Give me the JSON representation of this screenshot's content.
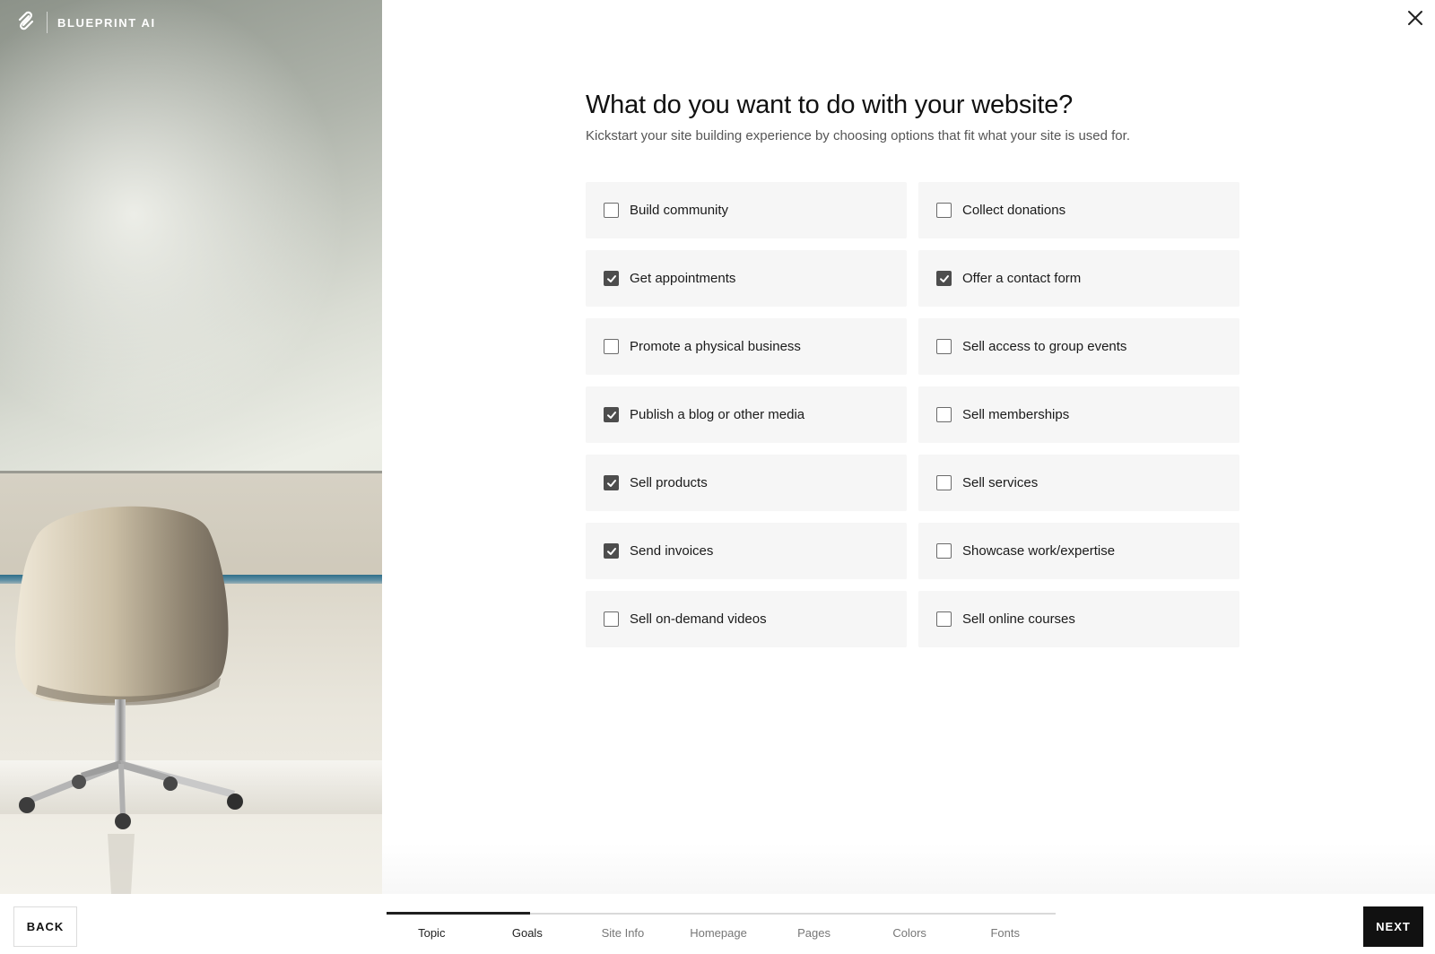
{
  "brand": {
    "name": "BLUEPRINT AI",
    "logo_icon": "squarespace-logo-icon"
  },
  "close": {
    "icon": "close-icon"
  },
  "main": {
    "title": "What do you want to do with your website?",
    "subtitle": "Kickstart your site building experience by choosing options that fit what your site is used for.",
    "options": [
      {
        "label": "Build community",
        "checked": false
      },
      {
        "label": "Collect donations",
        "checked": false
      },
      {
        "label": "Get appointments",
        "checked": true
      },
      {
        "label": "Offer a contact form",
        "checked": true
      },
      {
        "label": "Promote a physical business",
        "checked": false
      },
      {
        "label": "Sell access to group events",
        "checked": false
      },
      {
        "label": "Publish a blog or other media",
        "checked": true
      },
      {
        "label": "Sell memberships",
        "checked": false
      },
      {
        "label": "Sell products",
        "checked": true
      },
      {
        "label": "Sell services",
        "checked": false
      },
      {
        "label": "Send invoices",
        "checked": true
      },
      {
        "label": "Showcase work/expertise",
        "checked": false
      },
      {
        "label": "Sell on-demand videos",
        "checked": false
      },
      {
        "label": "Sell online courses",
        "checked": false
      }
    ]
  },
  "footer": {
    "back_label": "BACK",
    "next_label": "NEXT",
    "steps": [
      "Topic",
      "Goals",
      "Site Info",
      "Homepage",
      "Pages",
      "Colors",
      "Fonts"
    ],
    "current_step": "Goals",
    "progress_fraction": 0.214
  }
}
